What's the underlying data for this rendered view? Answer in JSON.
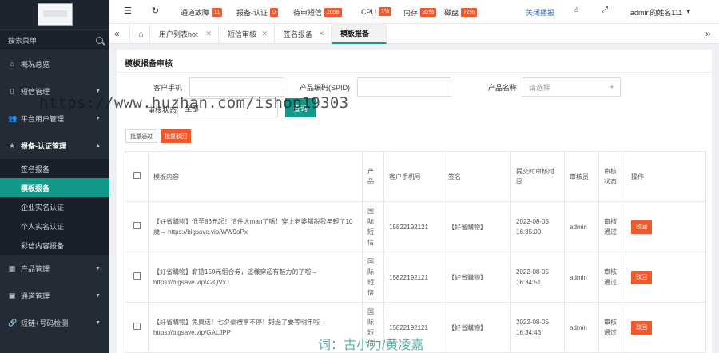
{
  "sidebar": {
    "search_label": "搜索菜单",
    "menu": [
      {
        "label": "概况总览",
        "icon": "home-icon"
      },
      {
        "label": "短信管理",
        "icon": "message-icon",
        "arrow": "▼"
      },
      {
        "label": "平台用户管理",
        "icon": "users-icon",
        "arrow": "▼"
      },
      {
        "label": "报备-认证管理",
        "icon": "star-icon",
        "arrow": "▲"
      }
    ],
    "sub_items": [
      "签名报备",
      "模板报备",
      "企业实名认证",
      "个人实名认证",
      "彩信内容报备"
    ],
    "menu_bottom": [
      {
        "label": "产品管理",
        "icon": "grid-icon",
        "arrow": "▼"
      },
      {
        "label": "通道管理",
        "icon": "channel-icon",
        "arrow": "▼"
      },
      {
        "label": "短链+号码检测",
        "icon": "link-icon",
        "arrow": "▼"
      }
    ]
  },
  "topbar": {
    "stats": [
      {
        "label": "通道故障",
        "value": "11"
      },
      {
        "label": "报备-认证",
        "value": "0"
      },
      {
        "label": "待审短信",
        "value": "2058"
      },
      {
        "label": "CPU",
        "value": "1%"
      },
      {
        "label": "内存",
        "value": "32%"
      },
      {
        "label": "磁盘",
        "value": "72%"
      }
    ],
    "close_broadcast": "关闭播报",
    "user_name": "admin的姓名111"
  },
  "tabs": [
    {
      "label": "用户列表hot"
    },
    {
      "label": "短信审核"
    },
    {
      "label": "签名报备"
    },
    {
      "label": "模板报备"
    }
  ],
  "panel": {
    "title": "模板报备审核",
    "filters": {
      "customer_phone_label": "客户手机",
      "product_code_label": "产品编码(SPID)",
      "product_name_label": "产品名称",
      "product_name_placeholder": "请选择",
      "review_status_label": "审核状态",
      "review_status_value": "全部"
    },
    "query_button": "查询",
    "batch_pass": "批量通过",
    "batch_reject": "批量驳回"
  },
  "table": {
    "headers": [
      "模板内容",
      "产品",
      "客户手机号",
      "签名",
      "提交时审核时间",
      "审核员",
      "审核状态",
      "操作"
    ],
    "rows": [
      {
        "content": "【好省購物】低至86元起！這件大man了嗎！穿上老婆都說我年輕了10歲→ https://bigsave.vip/WW9oPx",
        "product": "国际短信",
        "phone": "15822192121",
        "sign": "【好省購物】",
        "time": "2022-08-05 16:35:00",
        "reviewer": "admin",
        "status": "审核通过",
        "action": "驳回"
      },
      {
        "content": "【好省購物】嶄搶150元組合劵，這樣穿超有魅力的了啦→ https://bigsave.vip/42QVxJ",
        "product": "国际短信",
        "phone": "15822192121",
        "sign": "【好省購物】",
        "time": "2022-08-05 16:34:51",
        "reviewer": "admin",
        "status": "审核通过",
        "action": "驳回"
      },
      {
        "content": "【好省購物】免費送！七夕豪禮享不停！錯過了要等明年啦→ https://bigsave.vip/GALJPP",
        "product": "国际短信",
        "phone": "15822192121",
        "sign": "【好省購物】",
        "time": "2022-08-05 16:34:43",
        "reviewer": "admin",
        "status": "审核通过",
        "action": "驳回"
      }
    ]
  },
  "watermarks": {
    "url": "https://www.huzhan.com/ishop19303",
    "author": "词：古小力/黄凌嘉"
  },
  "colors": {
    "accent": "#139989",
    "badge": "#f1582c",
    "sidebar_bg": "#222b36"
  }
}
